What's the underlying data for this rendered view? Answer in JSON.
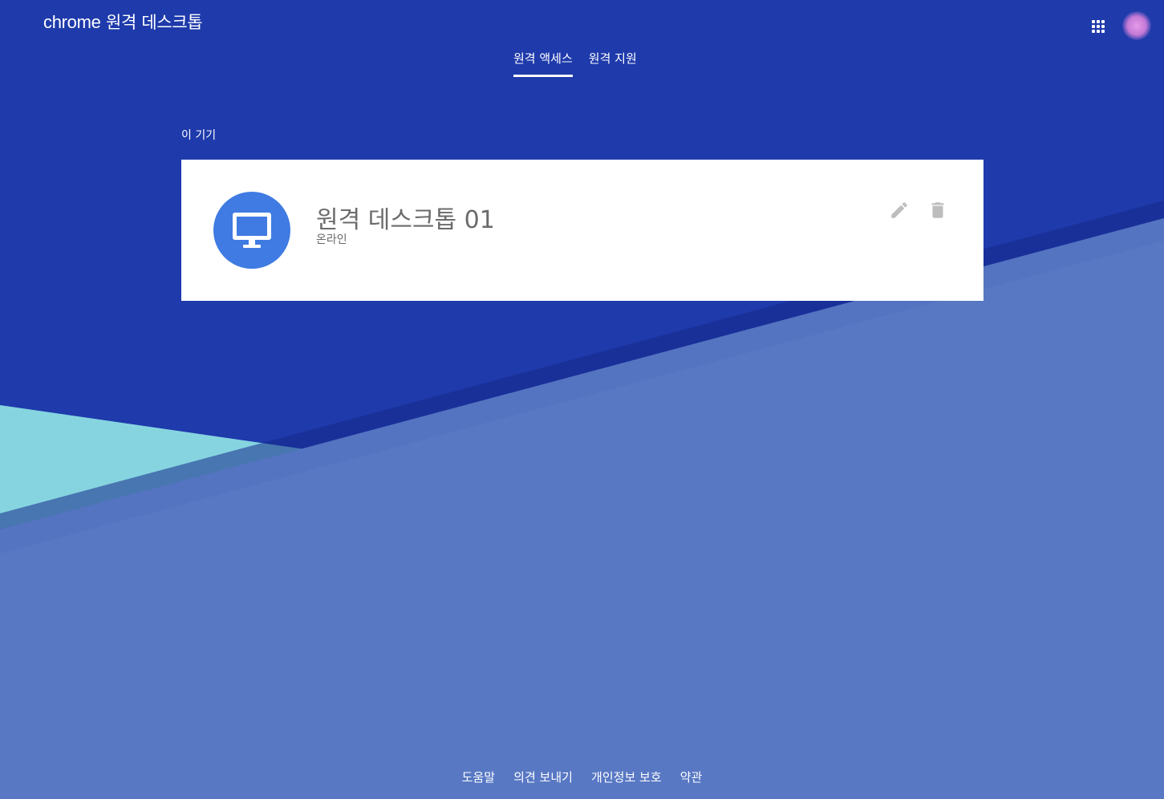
{
  "app": {
    "logo_brand": "chrome",
    "logo_product": "원격 데스크톱"
  },
  "header": {
    "apps_icon": "apps-grid-icon",
    "avatar_icon": "account-avatar"
  },
  "tabs": [
    {
      "label": "원격 액세스",
      "active": true
    },
    {
      "label": "원격 지원",
      "active": false
    }
  ],
  "section": {
    "title": "이 기기"
  },
  "device": {
    "icon": "monitor-icon",
    "name": "원격 데스크톱 01",
    "status": "온라인",
    "edit_icon": "pencil-icon",
    "delete_icon": "trash-icon"
  },
  "footer": {
    "links": [
      "도움말",
      "의견 보내기",
      "개인정보 보호",
      "약관"
    ]
  },
  "colors": {
    "background_dark": "#1e3aab",
    "background_mid": "#5878c4",
    "background_light": "#86d4e0",
    "device_icon_bg": "#3f7be2",
    "card_bg": "#ffffff"
  }
}
